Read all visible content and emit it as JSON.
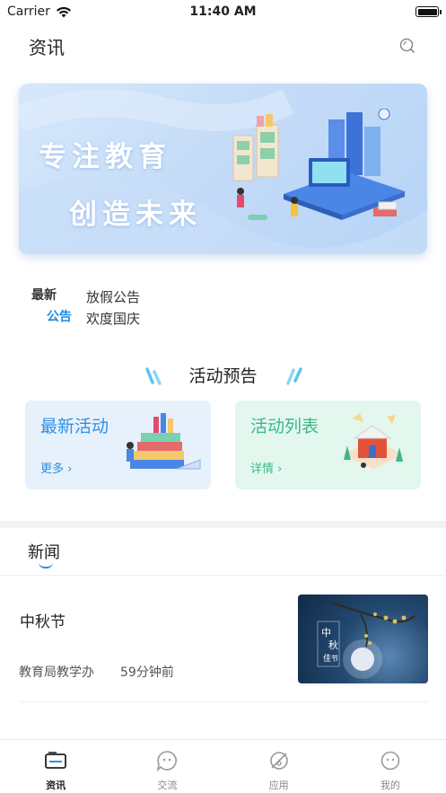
{
  "status_bar": {
    "carrier": "Carrier",
    "time": "11:40 AM"
  },
  "nav": {
    "title": "资讯"
  },
  "banner": {
    "line1": "专注教育",
    "line2": "创造未来"
  },
  "announcement": {
    "tag_top": "最新",
    "tag_bottom": "公告",
    "items": [
      "放假公告",
      "欢度国庆"
    ]
  },
  "activity_section": {
    "title": "活动预告"
  },
  "cards": [
    {
      "title": "最新活动",
      "link": "更多 ›"
    },
    {
      "title": "活动列表",
      "link": "详情 ›"
    }
  ],
  "news_tab": {
    "label": "新闻"
  },
  "news_items": [
    {
      "title": "中秋节",
      "source": "教育局教学办",
      "time": "59分钟前",
      "thumb_text": "中秋佳节"
    }
  ],
  "tabbar": [
    {
      "label": "资讯",
      "icon": "news-icon",
      "active": true
    },
    {
      "label": "交流",
      "icon": "chat-icon",
      "active": false
    },
    {
      "label": "应用",
      "icon": "apps-icon",
      "active": false
    },
    {
      "label": "我的",
      "icon": "profile-icon",
      "active": false
    }
  ],
  "colors": {
    "accent": "#2f8fe6",
    "green": "#3ab88a"
  }
}
